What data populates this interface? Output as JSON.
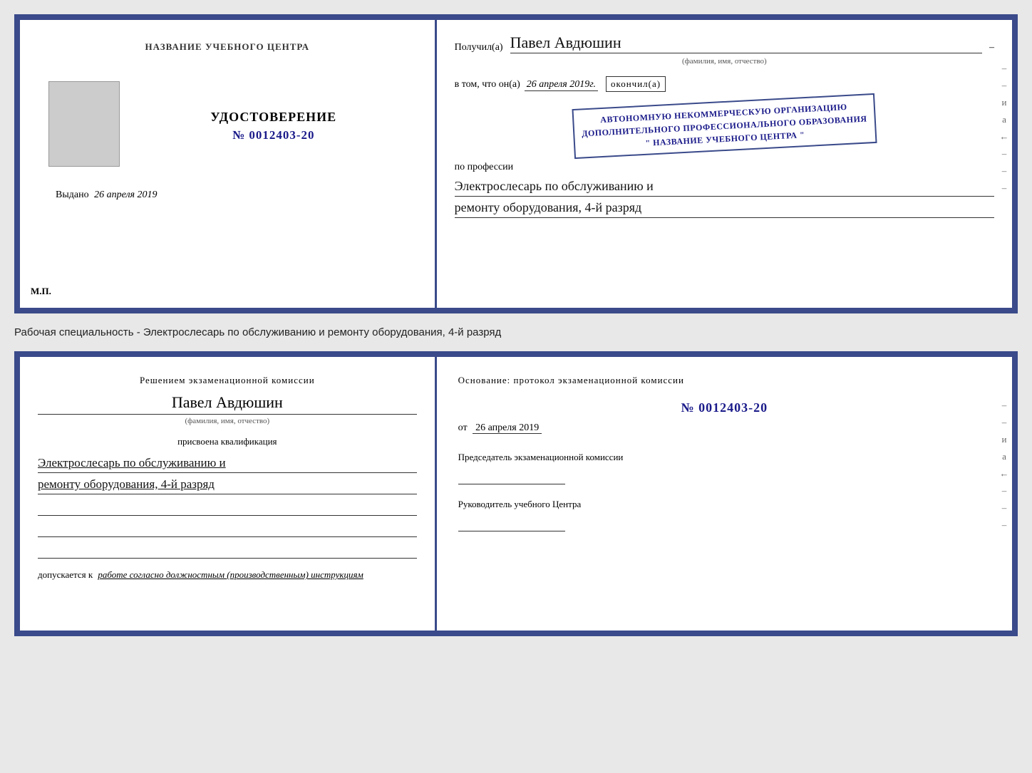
{
  "topDoc": {
    "left": {
      "title": "НАЗВАНИЕ УЧЕБНОГО ЦЕНТРА",
      "certLabel": "УДОСТОВЕРЕНИЕ",
      "certNumber": "№ 0012403-20",
      "issuedLabel": "Выдано",
      "issuedDate": "26 апреля 2019",
      "mpLabel": "М.П."
    },
    "right": {
      "recipientLabel": "Получил(а)",
      "recipientName": "Павел Авдюшин",
      "fioLabel": "(фамилия, имя, отчество)",
      "vtomLabel": "в том, что он(а)",
      "vtomDate": "26 апреля 2019г.",
      "okonchilLabel": "окончил(а)",
      "orgLine1": "АВТОНОМНУЮ НЕКОММЕРЧЕСКУЮ ОРГАНИЗАЦИЮ",
      "orgLine2": "ДОПОЛНИТЕЛЬНОГО ПРОФЕССИОНАЛЬНОГО ОБРАЗОВАНИЯ",
      "orgLine3": "\" НАЗВАНИЕ УЧЕБНОГО ЦЕНТРА \"",
      "professionLabel": "по профессии",
      "professionLine1": "Электрослесарь по обслуживанию и",
      "professionLine2": "ремонту оборудования, 4-й разряд"
    }
  },
  "specialtyText": "Рабочая специальность - Электрослесарь по обслуживанию и ремонту оборудования, 4-й разряд",
  "bottomDoc": {
    "left": {
      "resolutionTitle": "Решением экзаменационной комиссии",
      "personName": "Павел Авдюшин",
      "fioLabel": "(фамилия, имя, отчество)",
      "qualificationLabel": "присвоена квалификация",
      "qualificationLine1": "Электрослесарь по обслуживанию и",
      "qualificationLine2": "ремонту оборудования, 4-й разряд",
      "допускаетсяLabel": "допускается к",
      "допускаетсяText": "работе согласно должностным (производственным) инструкциям"
    },
    "right": {
      "osnovTitle": "Основание: протокол экзаменационной комиссии",
      "protocolNumber": "№ 0012403-20",
      "dateLabel": "от",
      "dateValue": "26 апреля 2019",
      "chairmanLabel": "Председатель экзаменационной комиссии",
      "headLabel": "Руководитель учебного Центра"
    }
  },
  "rightStrip": {
    "items": [
      "и",
      "а",
      "←",
      "–",
      "–",
      "–",
      "–",
      "–"
    ]
  }
}
